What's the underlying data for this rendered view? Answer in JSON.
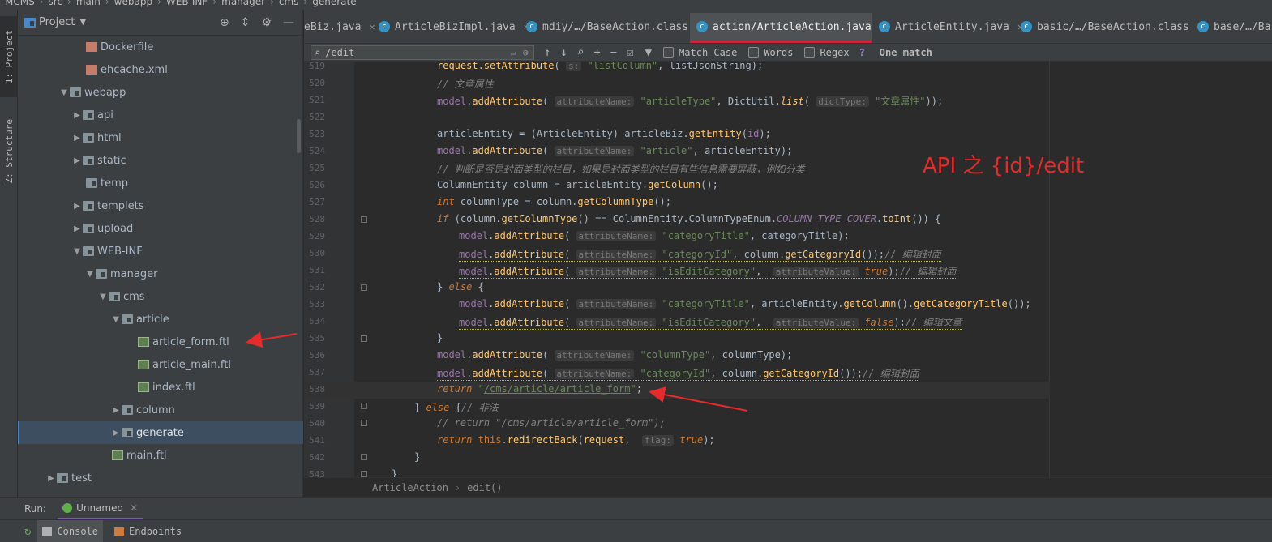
{
  "breadcrumb_top": [
    "MCMS",
    "src",
    "main",
    "webapp",
    "WEB-INF",
    "manager",
    "cms",
    "generate"
  ],
  "tool_strip": {
    "project_tab": "1: Project",
    "structure_tab": "Z: Structure"
  },
  "project_panel": {
    "title": "Project",
    "tree": [
      {
        "label": "Dockerfile",
        "kind": "file",
        "depth": 4
      },
      {
        "label": "ehcache.xml",
        "kind": "file",
        "depth": 4
      },
      {
        "label": "webapp",
        "kind": "folder",
        "depth": 2,
        "expanded": true
      },
      {
        "label": "api",
        "kind": "folder",
        "depth": 3
      },
      {
        "label": "html",
        "kind": "folder",
        "depth": 3
      },
      {
        "label": "static",
        "kind": "folder",
        "depth": 3
      },
      {
        "label": "temp",
        "kind": "folder",
        "depth": 3
      },
      {
        "label": "templets",
        "kind": "folder",
        "depth": 3
      },
      {
        "label": "upload",
        "kind": "folder",
        "depth": 3
      },
      {
        "label": "WEB-INF",
        "kind": "folder",
        "depth": 3,
        "expanded": true
      },
      {
        "label": "manager",
        "kind": "folder",
        "depth": 4,
        "expanded": true
      },
      {
        "label": "cms",
        "kind": "folder",
        "depth": 5,
        "expanded": true
      },
      {
        "label": "article",
        "kind": "folder",
        "depth": 6,
        "expanded": true
      },
      {
        "label": "article_form.ftl",
        "kind": "ftl",
        "depth": 7
      },
      {
        "label": "article_main.ftl",
        "kind": "ftl",
        "depth": 7
      },
      {
        "label": "index.ftl",
        "kind": "ftl",
        "depth": 7
      },
      {
        "label": "column",
        "kind": "folder",
        "depth": 6
      },
      {
        "label": "generate",
        "kind": "folder",
        "depth": 6,
        "selected": true
      },
      {
        "label": "main.ftl",
        "kind": "ftl",
        "depth": 5
      },
      {
        "label": "test",
        "kind": "folder",
        "depth": 1
      }
    ]
  },
  "tabs": [
    {
      "label": "eBiz.java",
      "active": false
    },
    {
      "label": "ArticleBizImpl.java",
      "active": false
    },
    {
      "label": "mdiy/…/BaseAction.class",
      "active": false
    },
    {
      "label": "action/ArticleAction.java",
      "active": true
    },
    {
      "label": "ArticleEntity.java",
      "active": false
    },
    {
      "label": "basic/…/BaseAction.class",
      "active": false
    },
    {
      "label": "base/…/Bas",
      "active": false
    }
  ],
  "search": {
    "query": "/edit",
    "options": [
      "Match_Case",
      "Words",
      "Regex"
    ],
    "help": "?",
    "result": "One match"
  },
  "line_numbers": [
    "519",
    "520",
    "521",
    "522",
    "523",
    "524",
    "525",
    "526",
    "527",
    "528",
    "529",
    "530",
    "531",
    "532",
    "533",
    "534",
    "535",
    "536",
    "537",
    "538",
    "539",
    "540",
    "541",
    "542",
    "543"
  ],
  "annotation": "API 之 {id}/edit",
  "editor_breadcrumb": [
    "ArticleAction",
    "edit()"
  ],
  "run_bar": {
    "label": "Run:",
    "config": "Unnamed"
  },
  "console_bar": {
    "console_tab": "Console",
    "endpoints_tab": "Endpoints"
  },
  "colors": {
    "annotation": "#e52b2b",
    "active_tab_underline": "#c9273c",
    "selection": "#3c4e5f"
  }
}
